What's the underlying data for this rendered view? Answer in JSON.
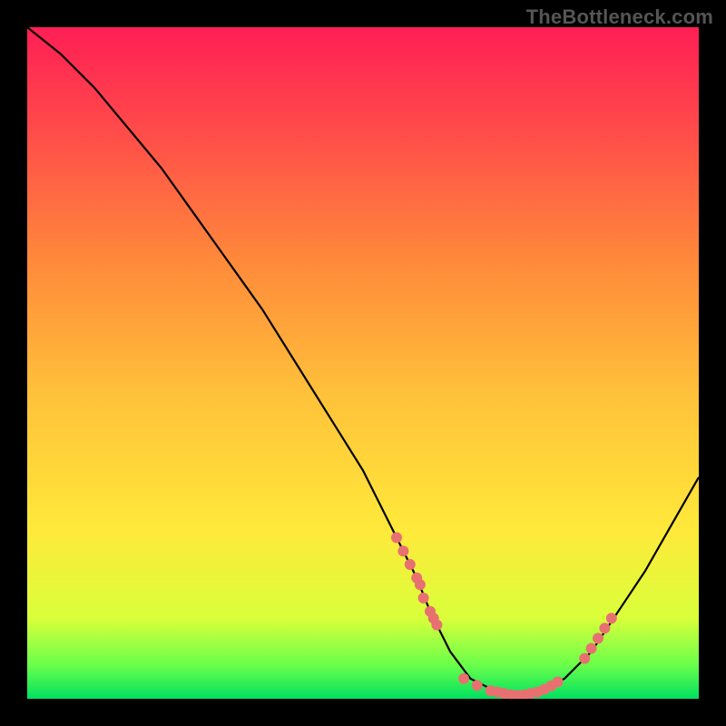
{
  "watermark": "TheBottleneck.com",
  "chart_data": {
    "type": "line",
    "title": "",
    "xlabel": "",
    "ylabel": "",
    "xlim": [
      0,
      100
    ],
    "ylim": [
      0,
      100
    ],
    "curve": {
      "name": "bottleneck-curve",
      "x": [
        0,
        5,
        10,
        15,
        20,
        25,
        30,
        35,
        40,
        45,
        50,
        55,
        58,
        60,
        63,
        66,
        70,
        73,
        76,
        80,
        84,
        88,
        92,
        96,
        100
      ],
      "y": [
        100,
        96,
        91,
        85,
        79,
        72,
        65,
        58,
        50,
        42,
        34,
        24,
        18,
        13,
        7,
        3,
        1,
        0.5,
        1,
        3,
        7,
        13,
        19,
        26,
        33
      ]
    },
    "dot_clusters": [
      {
        "name": "left-falling-cluster",
        "x": [
          55,
          56,
          57,
          58,
          58.5,
          59,
          60,
          60.5,
          61
        ],
        "y": [
          24,
          22,
          20,
          18,
          17,
          15,
          13,
          12,
          11
        ]
      },
      {
        "name": "valley-cluster",
        "x": [
          65,
          67,
          69,
          70,
          71,
          72,
          73,
          74,
          75,
          76,
          77,
          78,
          79
        ],
        "y": [
          3,
          2,
          1.2,
          1,
          0.8,
          0.6,
          0.5,
          0.6,
          0.8,
          1,
          1.4,
          1.9,
          2.5
        ]
      },
      {
        "name": "right-rising-cluster",
        "x": [
          83,
          84,
          85,
          86,
          87
        ],
        "y": [
          6,
          7.5,
          9,
          10.5,
          12
        ]
      }
    ],
    "background_gradient": {
      "stops": [
        {
          "offset": 0.0,
          "color": "#00e060"
        },
        {
          "offset": 0.05,
          "color": "#6aff4a"
        },
        {
          "offset": 0.12,
          "color": "#d9ff3a"
        },
        {
          "offset": 0.25,
          "color": "#ffe93a"
        },
        {
          "offset": 0.45,
          "color": "#ffc23a"
        },
        {
          "offset": 0.65,
          "color": "#ff8a3a"
        },
        {
          "offset": 0.85,
          "color": "#ff4a4a"
        },
        {
          "offset": 1.0,
          "color": "#ff1e55"
        }
      ]
    },
    "dot_color": "#e87070",
    "curve_color": "#000000"
  }
}
